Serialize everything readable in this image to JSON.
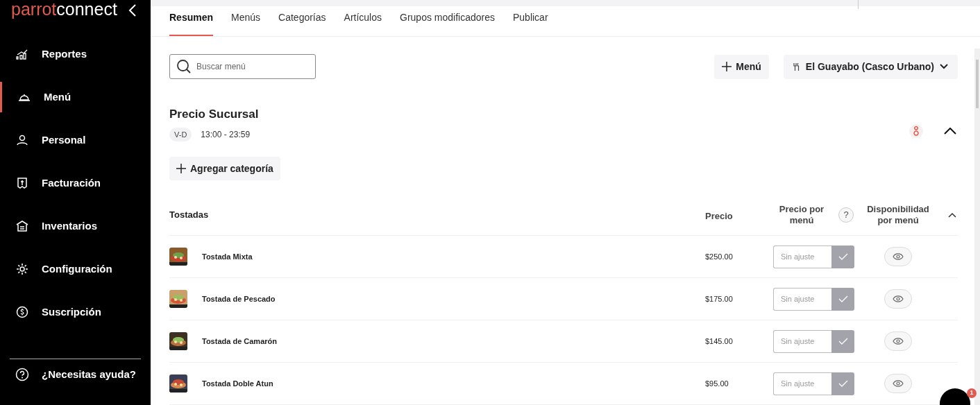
{
  "sidebar": {
    "logo": {
      "accent": "parrot",
      "rest": "connect"
    },
    "items": [
      {
        "label": "Reportes",
        "selected": false
      },
      {
        "label": "Menú",
        "selected": true
      },
      {
        "label": "Personal",
        "selected": false
      },
      {
        "label": "Facturación",
        "selected": false
      },
      {
        "label": "Inventarios",
        "selected": false
      },
      {
        "label": "Configuración",
        "selected": false
      },
      {
        "label": "Suscripción",
        "selected": false
      }
    ],
    "help": "¿Necesitas ayuda?"
  },
  "tabs": [
    {
      "label": "Resumen",
      "selected": true
    },
    {
      "label": "Menús",
      "selected": false
    },
    {
      "label": "Categorías",
      "selected": false
    },
    {
      "label": "Artículos",
      "selected": false
    },
    {
      "label": "Grupos modificadores",
      "selected": false
    },
    {
      "label": "Publicar",
      "selected": false
    }
  ],
  "search": {
    "placeholder": "Buscar menú"
  },
  "add_menu_button": "Menú",
  "store_selector": "El Guayabo (Casco Urbano)",
  "menu": {
    "title": "Precio Sucursal",
    "days": "V-D",
    "hours": "13:00 - 23:59",
    "expanded": true
  },
  "add_category_button": "Agregar categoría",
  "table": {
    "help_button": "?",
    "columns": [
      "Tostadas",
      "Precio",
      "Precio por menú",
      "Disponibilidad por menú"
    ],
    "rows": [
      {
        "name": "Tostada Mixta",
        "price": "$250.00",
        "placeholder": "Sin ajuste"
      },
      {
        "name": "Tostada de Pescado",
        "price": "$175.00",
        "placeholder": "Sin ajuste"
      },
      {
        "name": "Tostada de Camarón",
        "price": "$145.00",
        "placeholder": "Sin ajuste"
      },
      {
        "name": "Tostada Doble Atun",
        "price": "$95.00",
        "placeholder": "Sin ajuste"
      }
    ]
  },
  "chat": {
    "badge": "1"
  }
}
